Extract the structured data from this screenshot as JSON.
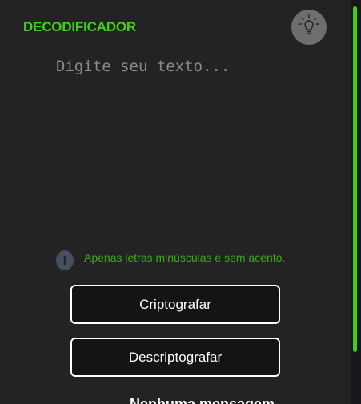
{
  "header": {
    "logo_text": "DECODIFICADOR",
    "theme_icon": "lightbulb-icon"
  },
  "input": {
    "placeholder": "Digite seu texto...",
    "value": ""
  },
  "info": {
    "icon": "exclamation-icon",
    "text": "Apenas letras minúsculas e sem acento."
  },
  "buttons": {
    "encrypt_label": "Criptografar",
    "decrypt_label": "Descriptografar"
  },
  "output": {
    "message_partial": "Nenhuma mensagem"
  },
  "colors": {
    "accent": "#3fd11a",
    "background": "#232323",
    "button_bg": "#141414",
    "button_border": "#ffffff"
  }
}
